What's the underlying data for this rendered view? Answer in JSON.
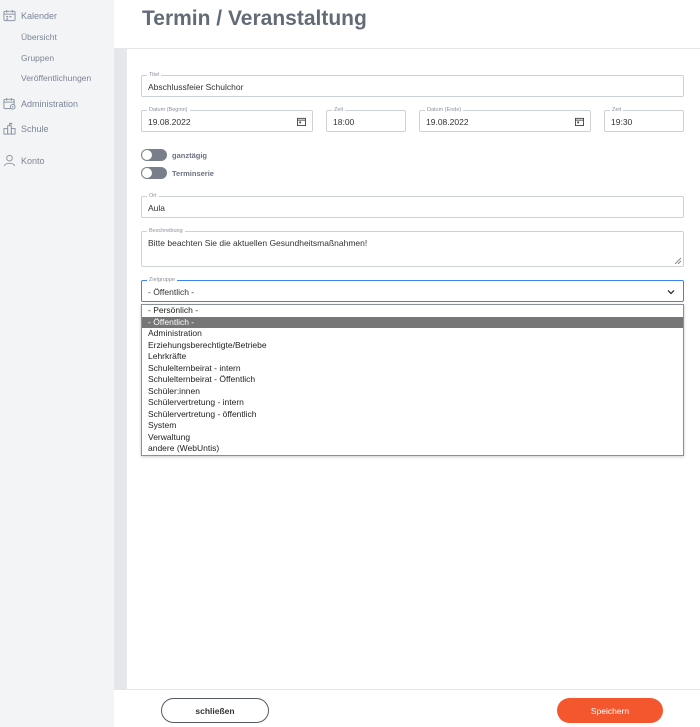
{
  "sidebar": {
    "calendar": {
      "label": "Kalender",
      "icon": "calendar-icon"
    },
    "calendar_sub": [
      "Übersicht",
      "Gruppen",
      "Veröffentlichungen"
    ],
    "administration": {
      "label": "Administration",
      "icon": "admin-calendar-icon"
    },
    "school": {
      "label": "Schule",
      "icon": "school-icon"
    },
    "account": {
      "label": "Konto",
      "icon": "user-icon"
    }
  },
  "header": {
    "title": "Termin / Veranstaltung"
  },
  "form": {
    "title": {
      "label": "Titel",
      "value": "Abschlussfeier Schulchor"
    },
    "date_start": {
      "label": "Datum (Beginn)",
      "value": "19.08.2022"
    },
    "time_start": {
      "label": "Zeit",
      "value": "18:00"
    },
    "date_end": {
      "label": "Datum (Ende)",
      "value": "19.08.2022"
    },
    "time_end": {
      "label": "Zeit",
      "value": "19:30"
    },
    "all_day": {
      "label": "ganztägig",
      "on": false
    },
    "series": {
      "label": "Terminserie",
      "on": false
    },
    "location": {
      "label": "Ort",
      "value": "Aula"
    },
    "description": {
      "label": "Beschreibung",
      "value": "Bitte beachten Sie die aktuellen Gesundheitsmaßnahmen!"
    },
    "audience": {
      "label": "Zielgruppe",
      "value": "- Öffentlich -",
      "options": [
        "- Persönlich -",
        "- Öffentlich -",
        "Administration",
        "Erziehungsberechtigte/Betriebe",
        "Lehrkräfte",
        "Schulelternbeirat - intern",
        "Schulelternbeirat - Öffentlich",
        "Schüler:innen",
        "Schülervertretung - intern",
        "Schülervertretung - öffentlich",
        "System",
        "Verwaltung",
        "andere (WebUntis)"
      ],
      "selected_index": 1
    }
  },
  "footer": {
    "close_label": "schließen",
    "save_label": "Speichern"
  },
  "colors": {
    "accent": "#f4572e",
    "focus": "#3b82f6",
    "selected_option": "#767676"
  }
}
